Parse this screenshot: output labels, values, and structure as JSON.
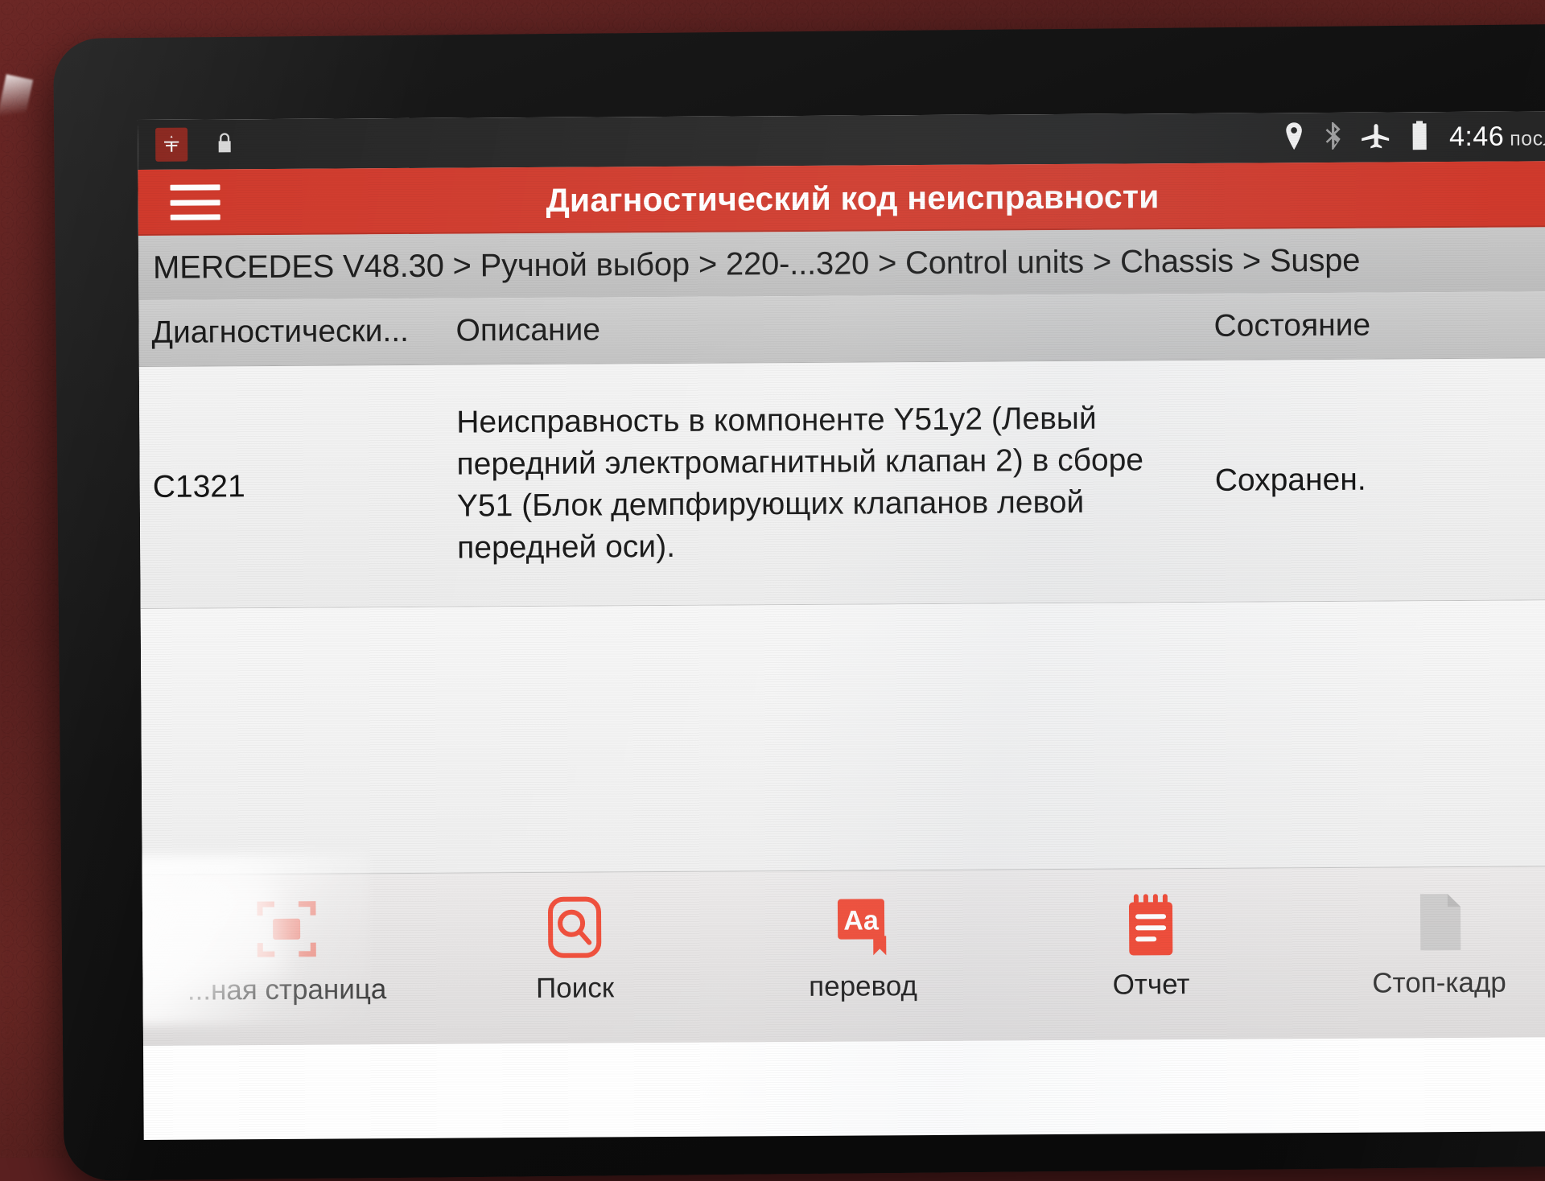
{
  "statusbar": {
    "app_icon": "car-app-icon",
    "lock_icon": "lock-icon",
    "location_icon": "location-pin-icon",
    "bluetooth_icon": "bluetooth-icon",
    "airplane_icon": "airplane-mode-icon",
    "battery_icon": "battery-icon",
    "time": "4:46",
    "time_suffix": "после"
  },
  "appbar": {
    "menu_icon": "hamburger-menu-icon",
    "title": "Диагностический код неисправности",
    "color": "#d03a2c"
  },
  "breadcrumb": {
    "text": "MERCEDES V48.30 > Ручной выбор > 220-...320 > Control units > Chassis > Suspe"
  },
  "table": {
    "headers": {
      "code": "Диагностически...",
      "description": "Описание",
      "state": "Состояние"
    },
    "rows": [
      {
        "code": "C1321",
        "description": "Неисправность в компоненте Y51y2 (Левый передний электромагнитный клапан 2) в сборе Y51 (Блок демпфирующих клапанов левой передней оси).",
        "state": "Сохранен."
      }
    ]
  },
  "toolbar": {
    "accent_color": "#f04a36",
    "items": [
      {
        "icon": "home-page-icon",
        "label": "...ная страница"
      },
      {
        "icon": "search-icon",
        "label": "Поиск"
      },
      {
        "icon": "translate-icon",
        "label": "перевод"
      },
      {
        "icon": "report-icon",
        "label": "Отчет"
      },
      {
        "icon": "freeze-frame-icon",
        "label": "Стоп-кадр"
      }
    ]
  }
}
